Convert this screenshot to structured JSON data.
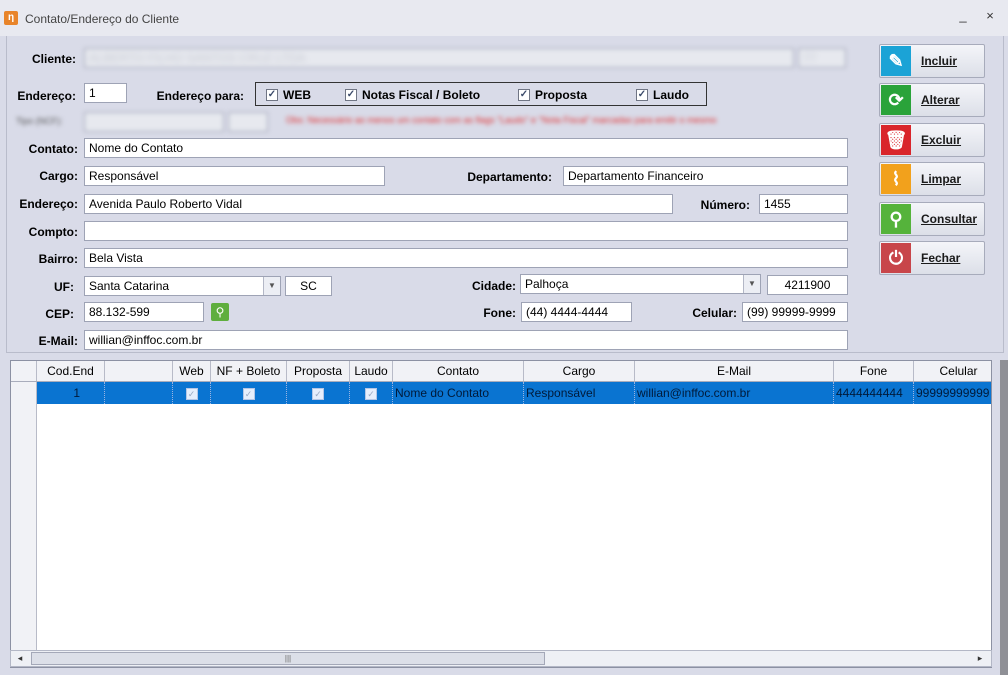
{
  "window": {
    "title": "Contato/Endereço do Cliente",
    "minimize": "_",
    "close": "×"
  },
  "form": {
    "cliente_label": "Cliente:",
    "cliente_value": "ALBERTO FILHO SANTOS CRUZ LTDA",
    "cliente_code": "77",
    "endereco_num_label": "Endereço:",
    "endereco_num_value": "1",
    "endereco_para_label": "Endereço para:",
    "checks": [
      {
        "label": "WEB",
        "checked": "✓"
      },
      {
        "label": "Notas Fiscal / Boleto",
        "checked": "✓"
      },
      {
        "label": "Proposta",
        "checked": "✓"
      },
      {
        "label": "Laudo",
        "checked": "✓"
      }
    ],
    "tipo_label": "Tipo (NCF):",
    "tipo_value": "",
    "warning_text": "Obs: Necessário ao menos um contato com as flags \"Laudo\" e \"Nota Fiscal\" marcadas para emitir o mesmo",
    "contato_label": "Contato:",
    "contato_value": "Nome do Contato",
    "cargo_label": "Cargo:",
    "cargo_value": "Responsável",
    "departamento_label": "Departamento:",
    "departamento_value": "Departamento Financeiro",
    "endereco_label": "Endereço:",
    "endereco_value": "Avenida Paulo Roberto Vidal",
    "numero_label": "Número:",
    "numero_value": "1455",
    "compto_label": "Compto:",
    "compto_value": "",
    "bairro_label": "Bairro:",
    "bairro_value": "Bela Vista",
    "uf_label": "UF:",
    "uf_value": "Santa Catarina",
    "uf_sigla": "SC",
    "cidade_label": "Cidade:",
    "cidade_value": "Palhoça",
    "cidade_code": "4211900",
    "cep_label": "CEP:",
    "cep_value": "88.132-599",
    "fone_label": "Fone:",
    "fone_value": "(44) 4444-4444",
    "celular_label": "Celular:",
    "celular_value": "(99) 99999-9999",
    "email_label": "E-Mail:",
    "email_value": "willian@inffoc.com.br"
  },
  "buttons": {
    "incluir": "Incluir",
    "alterar": "Alterar",
    "excluir": "Excluir",
    "limpar": "Limpar",
    "consultar": "Consultar",
    "fechar": "Fechar"
  },
  "grid": {
    "columns": [
      "Cod.End",
      "",
      "Web",
      "NF + Boleto",
      "Proposta",
      "Laudo",
      "Contato",
      "Cargo",
      "E-Mail",
      "Fone",
      "Celular"
    ],
    "rows": [
      {
        "cod_end": "1",
        "blank": "",
        "web": "✓",
        "nf_boleto": "✓",
        "proposta": "✓",
        "laudo": "✓",
        "contato": "Nome do Contato",
        "cargo": "Responsável",
        "email": "willian@inffoc.com.br",
        "fone": "4444444444",
        "celular": "99999999999"
      }
    ]
  },
  "scrollbar": {
    "left_arrow": "◂",
    "right_arrow": "▸",
    "grip": "|||"
  },
  "colors": {
    "selection": "#0a74d1",
    "warning": "#e03030",
    "incluir": "#1ba3d6",
    "alterar": "#2aa33a",
    "excluir": "#d9252b",
    "limpar": "#f2a11c",
    "consultar": "#55b33b",
    "fechar": "#c8454a"
  }
}
